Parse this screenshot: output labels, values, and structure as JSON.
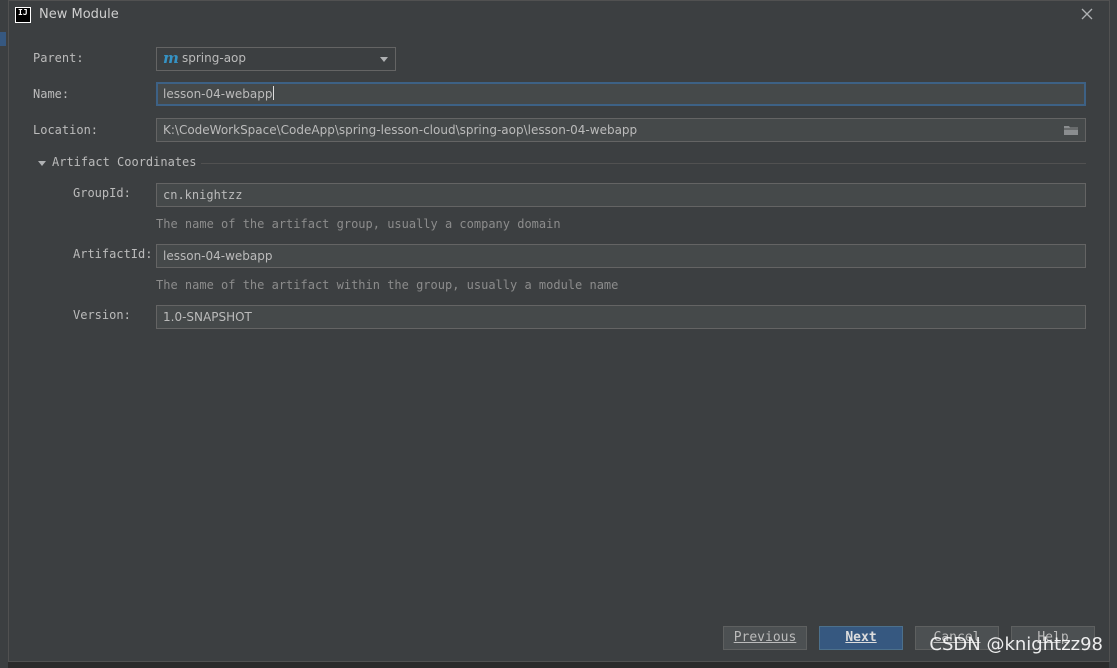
{
  "window": {
    "title": "New Module"
  },
  "form": {
    "parent_label": "Parent:",
    "parent_value": "spring-aop",
    "name_label": "Name:",
    "name_value": "lesson-04-webapp",
    "location_label": "Location:",
    "location_value": "K:\\CodeWorkSpace\\CodeApp\\spring-lesson-cloud\\spring-aop\\lesson-04-webapp"
  },
  "artifact": {
    "section_title": "Artifact Coordinates",
    "groupid_label": "GroupId:",
    "groupid_value": "cn.knightzz",
    "groupid_hint": "The name of the artifact group, usually a company domain",
    "artifactid_label": "ArtifactId:",
    "artifactid_value": "lesson-04-webapp",
    "artifactid_hint": "The name of the artifact within the group, usually a module name",
    "version_label": "Version:",
    "version_value": "1.0-SNAPSHOT"
  },
  "buttons": {
    "previous": "Previous",
    "next": "Next",
    "cancel": "Cancel",
    "help": "Help"
  },
  "watermark": "CSDN @knightzz98",
  "icons": {
    "app": "intellij-icon",
    "maven": "maven-module-icon",
    "folder": "folder-icon",
    "close": "close-icon"
  }
}
